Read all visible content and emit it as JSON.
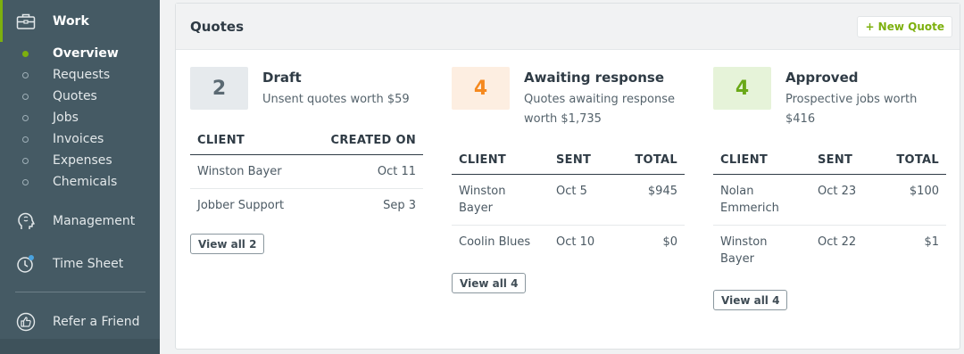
{
  "sidebar": {
    "work_label": "Work",
    "sub_items": [
      {
        "label": "Overview",
        "active": true
      },
      {
        "label": "Requests",
        "active": false
      },
      {
        "label": "Quotes",
        "active": false
      },
      {
        "label": "Jobs",
        "active": false
      },
      {
        "label": "Invoices",
        "active": false
      },
      {
        "label": "Expenses",
        "active": false
      },
      {
        "label": "Chemicals",
        "active": false
      }
    ],
    "management_label": "Management",
    "timesheet_label": "Time Sheet",
    "refer_label": "Refer a Friend"
  },
  "quotes": {
    "title": "Quotes",
    "new_quote_label": "+ New Quote",
    "draft": {
      "count": "2",
      "title": "Draft",
      "desc": "Unsent quotes worth $59",
      "headers": {
        "client": "CLIENT",
        "created": "CREATED ON"
      },
      "rows": [
        {
          "client": "Winston Bayer",
          "created": "Oct 11"
        },
        {
          "client": "Jobber Support",
          "created": "Sep 3"
        }
      ],
      "view_all": "View all 2"
    },
    "awaiting": {
      "count": "4",
      "title": "Awaiting response",
      "desc": "Quotes awaiting response worth $1,735",
      "headers": {
        "client": "CLIENT",
        "sent": "SENT",
        "total": "TOTAL"
      },
      "rows": [
        {
          "client": "Winston Bayer",
          "sent": "Oct 5",
          "total": "$945"
        },
        {
          "client": "Coolin Blues",
          "sent": "Oct 10",
          "total": "$0"
        }
      ],
      "view_all": "View all 4"
    },
    "approved": {
      "count": "4",
      "title": "Approved",
      "desc": "Prospective jobs worth $416",
      "headers": {
        "client": "CLIENT",
        "sent": "SENT",
        "total": "TOTAL"
      },
      "rows": [
        {
          "client": "Nolan Emmerich",
          "sent": "Oct 23",
          "total": "$100"
        },
        {
          "client": "Winston Bayer",
          "sent": "Oct 22",
          "total": "$1"
        }
      ],
      "view_all": "View all 4"
    }
  },
  "colors": {
    "sidebar_bg": "#455a64",
    "accent_green": "#7db00e",
    "draft_badge_bg": "#e6eaed",
    "awaiting_badge_bg": "#fdeee1",
    "approved_badge_bg": "#e6f3d9"
  },
  "icons": {
    "work": "toolbox-icon",
    "management": "head-icon",
    "timesheet": "clock-icon",
    "refer": "thumbs-up-icon"
  }
}
